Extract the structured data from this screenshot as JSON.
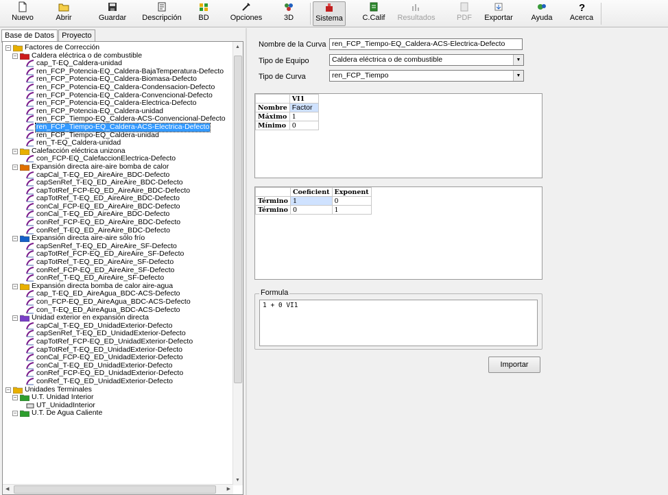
{
  "toolbar": {
    "nuevo": "Nuevo",
    "abrir": "Abrir",
    "guardar": "Guardar",
    "descripcion": "Descripción",
    "bd": "BD",
    "opciones": "Opciones",
    "tres_d": "3D",
    "sistema": "Sistema",
    "ccalif": "C.Calif",
    "resultados": "Resultados",
    "pdf": "PDF",
    "exportar": "Exportar",
    "ayuda": "Ayuda",
    "acerca": "Acerca"
  },
  "tabs": {
    "base_datos": "Base de Datos",
    "proyecto": "Proyecto"
  },
  "tree": [
    {
      "level": 0,
      "type": "folder",
      "expander": "minus",
      "label": "Factores de Corrección",
      "color": "#e8b000"
    },
    {
      "level": 1,
      "type": "folder",
      "expander": "minus",
      "label": "Caldera eléctrica o de combustible",
      "color": "#cc1b1b"
    },
    {
      "level": 2,
      "type": "curve",
      "label": "cap_T-EQ_Caldera-unidad"
    },
    {
      "level": 2,
      "type": "curve",
      "label": "ren_FCP_Potencia-EQ_Caldera-BajaTemperatura-Defecto"
    },
    {
      "level": 2,
      "type": "curve",
      "label": "ren_FCP_Potencia-EQ_Caldera-Biomasa-Defecto"
    },
    {
      "level": 2,
      "type": "curve",
      "label": "ren_FCP_Potencia-EQ_Caldera-Condensacion-Defecto"
    },
    {
      "level": 2,
      "type": "curve",
      "label": "ren_FCP_Potencia-EQ_Caldera-Convencional-Defecto"
    },
    {
      "level": 2,
      "type": "curve",
      "label": "ren_FCP_Potencia-EQ_Caldera-Electrica-Defecto"
    },
    {
      "level": 2,
      "type": "curve",
      "label": "ren_FCP_Potencia-EQ_Caldera-unidad"
    },
    {
      "level": 2,
      "type": "curve",
      "label": "ren_FCP_Tiempo-EQ_Caldera-ACS-Convencional-Defecto"
    },
    {
      "level": 2,
      "type": "curve",
      "label": "ren_FCP_Tiempo-EQ_Caldera-ACS-Electrica-Defecto",
      "selected": true
    },
    {
      "level": 2,
      "type": "curve",
      "label": "ren_FCP_Tiempo-EQ_Caldera-unidad"
    },
    {
      "level": 2,
      "type": "curve",
      "label": "ren_T-EQ_Caldera-unidad"
    },
    {
      "level": 1,
      "type": "folder",
      "expander": "minus",
      "label": "Calefacción eléctrica unizona",
      "color": "#e8b000"
    },
    {
      "level": 2,
      "type": "curve",
      "label": "con_FCP-EQ_CalefaccionElectrica-Defecto"
    },
    {
      "level": 1,
      "type": "folder",
      "expander": "minus",
      "label": "Expansión directa aire-aire bomba de calor",
      "color": "#e07000"
    },
    {
      "level": 2,
      "type": "curve",
      "label": "capCal_T-EQ_ED_AireAire_BDC-Defecto"
    },
    {
      "level": 2,
      "type": "curve",
      "label": "capSenRef_T-EQ_ED_AireAire_BDC-Defecto"
    },
    {
      "level": 2,
      "type": "curve",
      "label": "capTotRef_FCP-EQ_ED_AireAire_BDC-Defecto"
    },
    {
      "level": 2,
      "type": "curve",
      "label": "capTotRef_T-EQ_ED_AireAire_BDC-Defecto"
    },
    {
      "level": 2,
      "type": "curve",
      "label": "conCal_FCP-EQ_ED_AireAire_BDC-Defecto"
    },
    {
      "level": 2,
      "type": "curve",
      "label": "conCal_T-EQ_ED_AireAire_BDC-Defecto"
    },
    {
      "level": 2,
      "type": "curve",
      "label": "conRef_FCP-EQ_ED_AireAire_BDC-Defecto"
    },
    {
      "level": 2,
      "type": "curve",
      "label": "conRef_T-EQ_ED_AireAire_BDC-Defecto"
    },
    {
      "level": 1,
      "type": "folder",
      "expander": "minus",
      "label": "Expansión directa aire-aire sólo frío",
      "color": "#1560c9"
    },
    {
      "level": 2,
      "type": "curve",
      "label": "capSenRef_T-EQ_ED_AireAire_SF-Defecto"
    },
    {
      "level": 2,
      "type": "curve",
      "label": "capTotRef_FCP-EQ_ED_AireAire_SF-Defecto"
    },
    {
      "level": 2,
      "type": "curve",
      "label": "capTotRef_T-EQ_ED_AireAire_SF-Defecto"
    },
    {
      "level": 2,
      "type": "curve",
      "label": "conRef_FCP-EQ_ED_AireAire_SF-Defecto"
    },
    {
      "level": 2,
      "type": "curve",
      "label": "conRef_T-EQ_ED_AireAire_SF-Defecto"
    },
    {
      "level": 1,
      "type": "folder",
      "expander": "minus",
      "label": "Expansión directa bomba de calor aire-agua",
      "color": "#e8b000"
    },
    {
      "level": 2,
      "type": "curve",
      "label": "cap_T-EQ_ED_AireAgua_BDC-ACS-Defecto"
    },
    {
      "level": 2,
      "type": "curve",
      "label": "con_FCP-EQ_ED_AireAgua_BDC-ACS-Defecto"
    },
    {
      "level": 2,
      "type": "curve",
      "label": "con_T-EQ_ED_AireAgua_BDC-ACS-Defecto"
    },
    {
      "level": 1,
      "type": "folder",
      "expander": "minus",
      "label": "Unidad exterior en expansión directa",
      "color": "#7a3fc8"
    },
    {
      "level": 2,
      "type": "curve",
      "label": "capCal_T-EQ_ED_UnidadExterior-Defecto"
    },
    {
      "level": 2,
      "type": "curve",
      "label": "capSenRef_T-EQ_ED_UnidadExterior-Defecto"
    },
    {
      "level": 2,
      "type": "curve",
      "label": "capTotRef_FCP-EQ_ED_UnidadExterior-Defecto"
    },
    {
      "level": 2,
      "type": "curve",
      "label": "capTotRef_T-EQ_ED_UnidadExterior-Defecto"
    },
    {
      "level": 2,
      "type": "curve",
      "label": "conCal_FCP-EQ_ED_UnidadExterior-Defecto"
    },
    {
      "level": 2,
      "type": "curve",
      "label": "conCal_T-EQ_ED_UnidadExterior-Defecto"
    },
    {
      "level": 2,
      "type": "curve",
      "label": "conRef_FCP-EQ_ED_UnidadExterior-Defecto"
    },
    {
      "level": 2,
      "type": "curve",
      "label": "conRef_T-EQ_ED_UnidadExterior-Defecto"
    },
    {
      "level": 0,
      "type": "folder",
      "expander": "minus",
      "label": "Unidades Terminales",
      "color": "#e8b000"
    },
    {
      "level": 1,
      "type": "folder",
      "expander": "minus",
      "label": "U.T. Unidad Interior",
      "color": "#2e9e2e"
    },
    {
      "level": 2,
      "type": "unit",
      "label": "UT_UnidadInterior"
    },
    {
      "level": 1,
      "type": "folder",
      "expander": "minus",
      "label": "U.T. De Agua Caliente",
      "color": "#2e9e2e"
    }
  ],
  "form": {
    "nombre_curva_label": "Nombre de la Curva",
    "nombre_curva_value": "ren_FCP_Tiempo-EQ_Caldera-ACS-Electrica-Defecto",
    "tipo_equipo_label": "Tipo de Equipo",
    "tipo_equipo_value": "Caldera eléctrica o de combustible",
    "tipo_curva_label": "Tipo de Curva",
    "tipo_curva_value": "ren_FCP_Tiempo"
  },
  "vars_table": {
    "header": "VI1",
    "rows": [
      {
        "label": "Nombre",
        "value": "Factor"
      },
      {
        "label": "Máximo",
        "value": "1"
      },
      {
        "label": "Mínimo",
        "value": "0"
      }
    ]
  },
  "terms_table": {
    "headers": [
      "Coeficient",
      "Exponent"
    ],
    "rows": [
      {
        "label": "Término",
        "coef": "1",
        "exp": "0"
      },
      {
        "label": "Término",
        "coef": "0",
        "exp": "1"
      }
    ]
  },
  "formula": {
    "legend": "Formula",
    "text": "1 + 0 VI1"
  },
  "importar_label": "Importar"
}
